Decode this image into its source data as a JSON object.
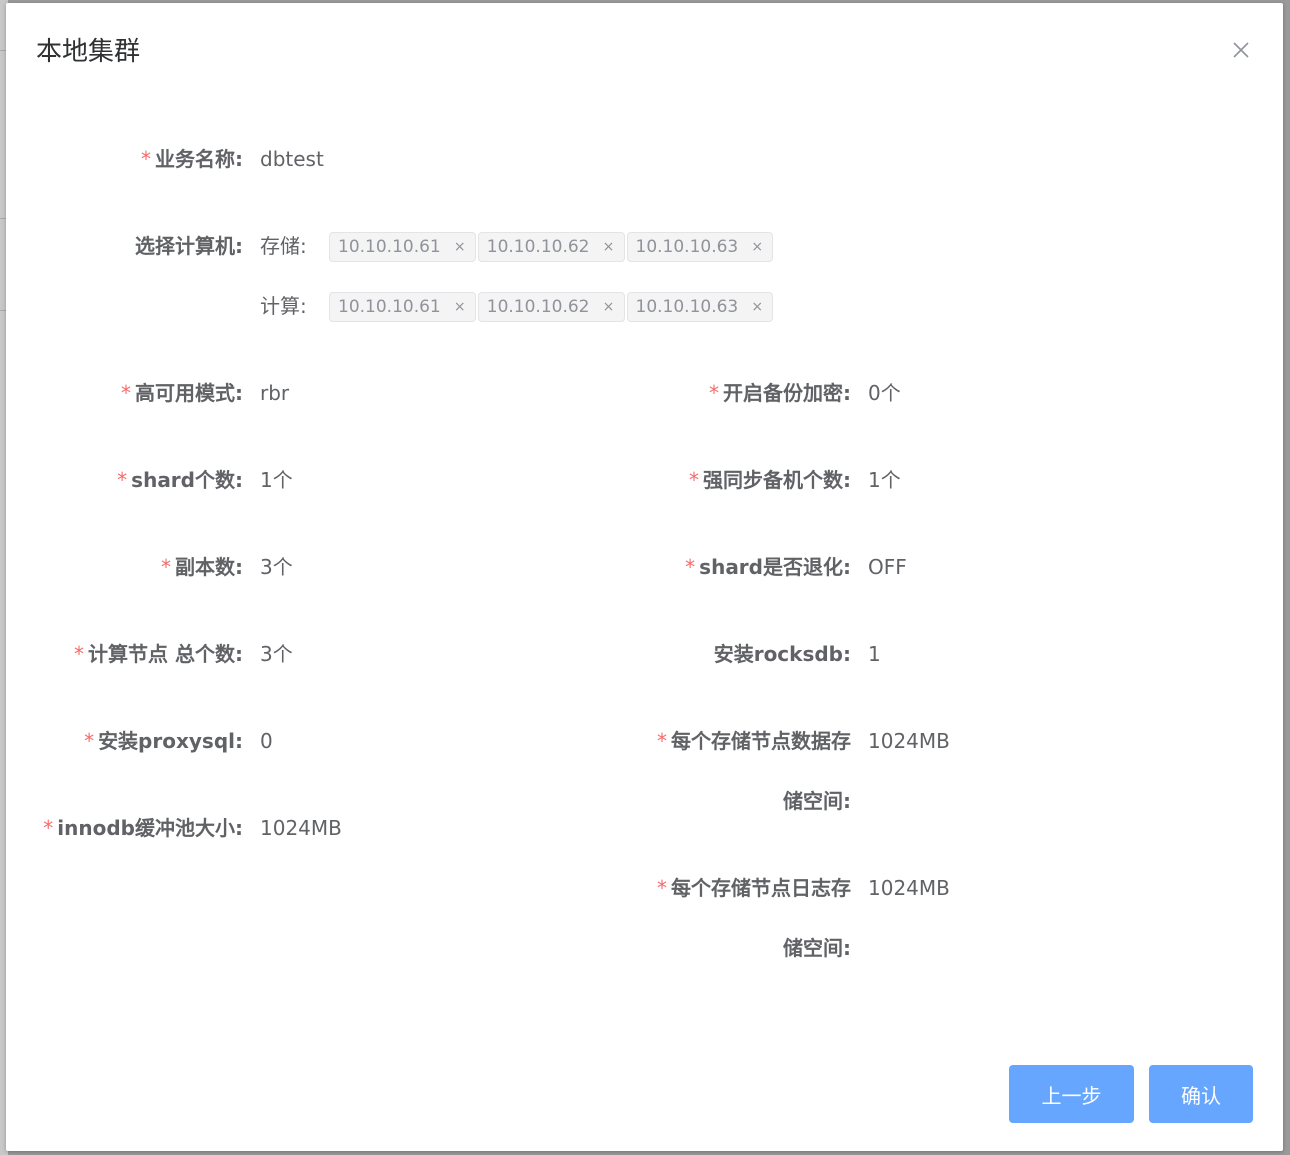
{
  "dialog": {
    "title": "本地集群",
    "close_icon": "close-icon"
  },
  "form": {
    "business_name": {
      "label": "业务名称:",
      "value": "dbtest"
    },
    "select_machines": {
      "label": "选择计算机:",
      "storage_label": "存储:",
      "storage_tags": [
        "10.10.10.61",
        "10.10.10.62",
        "10.10.10.63"
      ],
      "compute_label": "计算:",
      "compute_tags": [
        "10.10.10.61",
        "10.10.10.62",
        "10.10.10.63"
      ]
    },
    "ha_mode": {
      "label": "高可用模式:",
      "value": "rbr"
    },
    "backup_encrypt": {
      "label": "开启备份加密:",
      "value": "0个"
    },
    "shard_count": {
      "label": "shard个数:",
      "value": "1个"
    },
    "strong_sync_count": {
      "label": "强同步备机个数:",
      "value": "1个"
    },
    "replica_count": {
      "label": "副本数:",
      "value": "3个"
    },
    "shard_degrade": {
      "label": "shard是否退化:",
      "value": "OFF"
    },
    "compute_nodes": {
      "label": "计算节点 总个数:",
      "value": "3个"
    },
    "install_rocksdb": {
      "label": "安装rocksdb:",
      "value": "1"
    },
    "install_proxysql": {
      "label": "安装proxysql:",
      "value": "0"
    },
    "data_storage": {
      "label_line1": "每个存储节点数据存",
      "label_line2": "储空间:",
      "value": "1024MB"
    },
    "innodb_buffer": {
      "label": "innodb缓冲池大小:",
      "value": "1024MB"
    },
    "log_storage": {
      "label_line1": "每个存储节点日志存",
      "label_line2": "储空间:",
      "value": "1024MB"
    }
  },
  "footer": {
    "prev_label": "上一步",
    "confirm_label": "确认"
  }
}
